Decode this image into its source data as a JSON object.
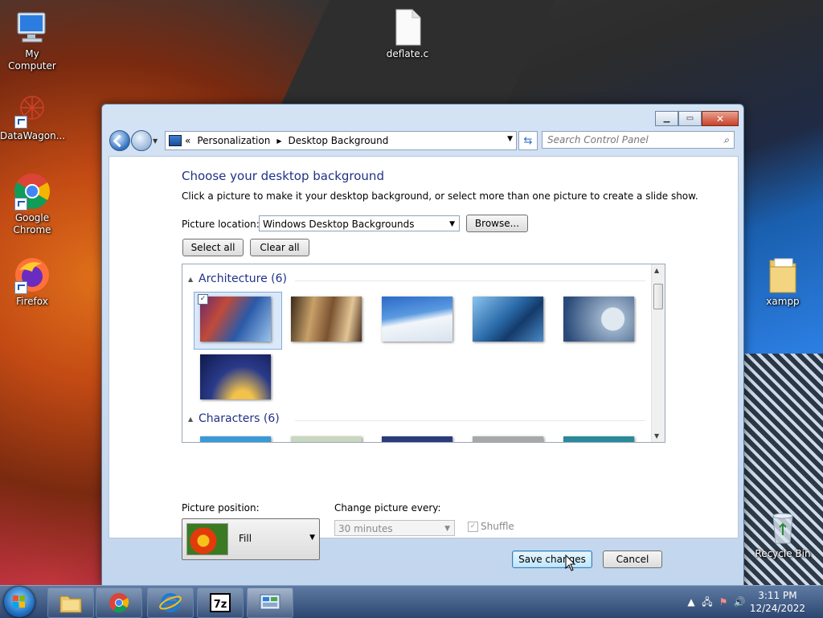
{
  "desktop": {
    "icons": [
      {
        "label": "My Computer"
      },
      {
        "label": "DataWagon..."
      },
      {
        "label": "Google Chrome"
      },
      {
        "label": "Firefox"
      },
      {
        "label": "deflate.c"
      },
      {
        "label": "xampp"
      },
      {
        "label": "Recycle Bin"
      }
    ]
  },
  "window": {
    "breadcrumbs": [
      "Personalization",
      "Desktop Background"
    ],
    "breadcrumb_prefix": "«",
    "search_placeholder": "Search Control Panel",
    "title": "Choose your desktop background",
    "subtitle": "Click a picture to make it your desktop background, or select more than one picture to create a slide show.",
    "picture_location_label": "Picture location:",
    "picture_location_value": "Windows Desktop Backgrounds",
    "browse_label": "Browse...",
    "select_all_label": "Select all",
    "clear_all_label": "Clear all",
    "groups": [
      {
        "name": "Architecture (6)"
      },
      {
        "name": "Characters (6)"
      }
    ],
    "picture_position_label": "Picture position:",
    "picture_position_value": "Fill",
    "change_every_label": "Change picture every:",
    "change_every_value": "30 minutes",
    "shuffle_label": "Shuffle",
    "save_label": "Save changes",
    "cancel_label": "Cancel"
  },
  "taskbar": {
    "time": "3:11 PM",
    "date": "12/24/2022"
  },
  "colors": {
    "heading": "#1e3287",
    "taskbar": "#2c4670"
  }
}
